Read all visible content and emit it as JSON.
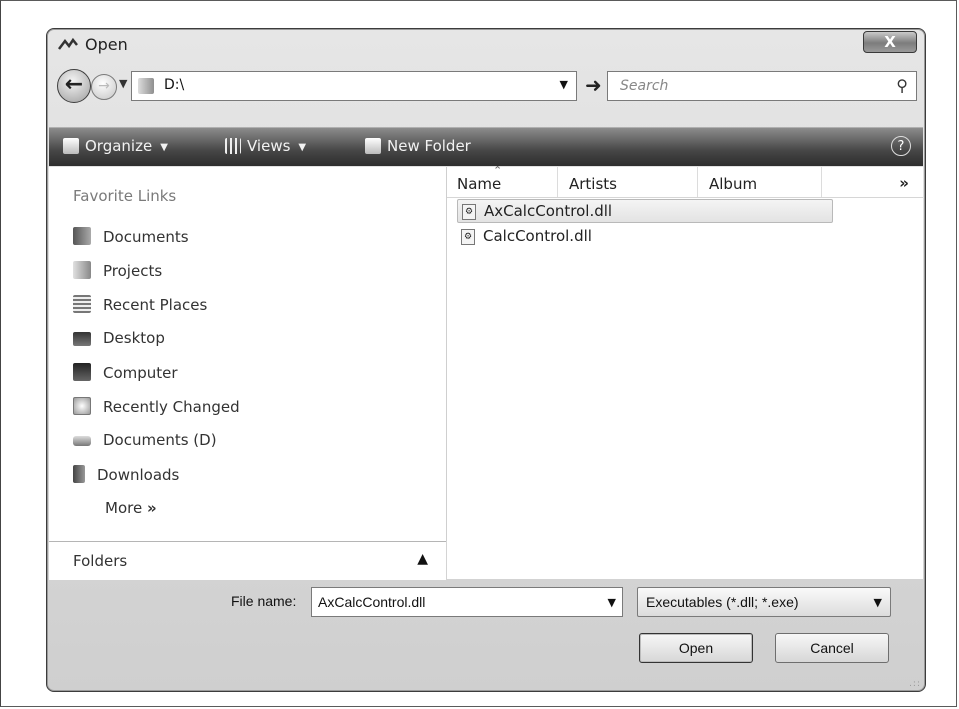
{
  "window": {
    "title": "Open",
    "close_label": "X"
  },
  "nav": {
    "back_icon": "back-arrow-icon",
    "forward_icon": "forward-arrow-icon",
    "address": "D:\\",
    "search_placeholder": "Search"
  },
  "toolbar": {
    "organize": "Organize",
    "views": "Views",
    "new_folder": "New Folder",
    "help": "?"
  },
  "sidebar": {
    "title": "Favorite Links",
    "items": [
      {
        "label": "Documents",
        "icon": "documents-icon"
      },
      {
        "label": "Projects",
        "icon": "folder-icon"
      },
      {
        "label": "Recent Places",
        "icon": "recent-places-icon"
      },
      {
        "label": "Desktop",
        "icon": "desktop-icon"
      },
      {
        "label": "Computer",
        "icon": "computer-icon"
      },
      {
        "label": "Recently Changed",
        "icon": "recently-changed-icon"
      },
      {
        "label": "Documents (D)",
        "icon": "drive-icon"
      },
      {
        "label": "Downloads",
        "icon": "downloads-icon"
      }
    ],
    "more": "More",
    "folders": "Folders"
  },
  "filelist": {
    "columns": [
      "Name",
      "Artists",
      "Album"
    ],
    "files": [
      {
        "name": "AxCalcControl.dll",
        "selected": true
      },
      {
        "name": "CalcControl.dll",
        "selected": false
      }
    ]
  },
  "bottom": {
    "filename_label": "File name:",
    "filename_value": "AxCalcControl.dll",
    "filetype_value": "Executables (*.dll; *.exe)",
    "open_label": "Open",
    "cancel_label": "Cancel"
  }
}
